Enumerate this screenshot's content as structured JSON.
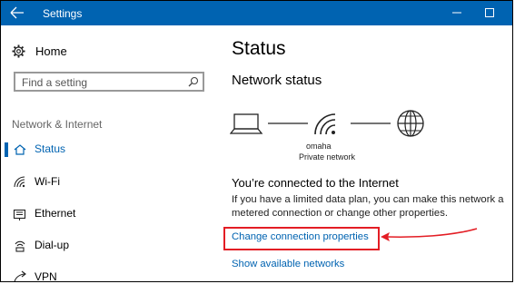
{
  "window": {
    "title": "Settings"
  },
  "sidebar": {
    "home_label": "Home",
    "search_placeholder": "Find a setting",
    "section_title": "Network & Internet",
    "items": [
      {
        "label": "Status",
        "icon": "home-network-icon",
        "active": true
      },
      {
        "label": "Wi-Fi",
        "icon": "wifi-icon",
        "active": false
      },
      {
        "label": "Ethernet",
        "icon": "ethernet-icon",
        "active": false
      },
      {
        "label": "Dial-up",
        "icon": "dialup-icon",
        "active": false
      },
      {
        "label": "VPN",
        "icon": "vpn-icon",
        "active": false
      }
    ]
  },
  "main": {
    "page_title": "Status",
    "section_heading": "Network status",
    "network_name": "omaha",
    "network_type": "Private network",
    "connected_heading": "You’re connected to the Internet",
    "description": "If you have a limited data plan, you can make this network a metered connection or change other properties.",
    "link_change": "Change connection properties",
    "link_show": "Show available networks"
  },
  "colors": {
    "accent": "#0063b1",
    "highlight": "#e31d24"
  }
}
